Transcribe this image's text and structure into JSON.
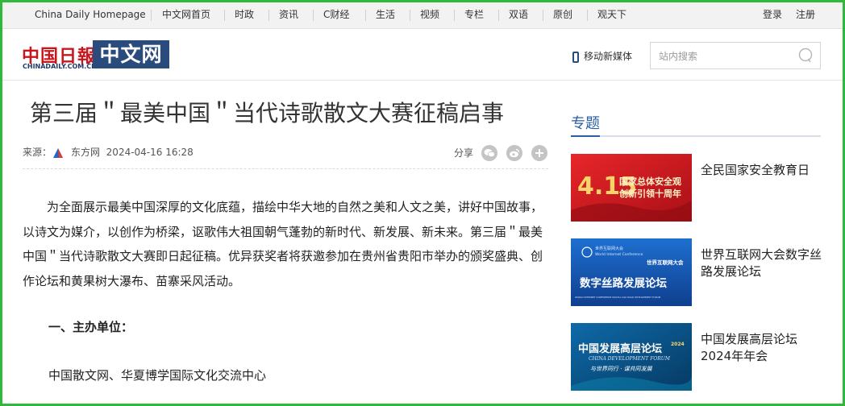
{
  "topnav": {
    "items": [
      "China Daily Homepage",
      "中文网首页",
      "时政",
      "资讯",
      "C财经",
      "生活",
      "视频",
      "专栏",
      "双语",
      "原创",
      "观天下"
    ],
    "login": "登录",
    "register": "注册"
  },
  "header": {
    "logo_cn": "中国日報",
    "logo_url": "CHINADAILY.COM.CN",
    "logo_zw": "中文网",
    "mobile_label": "移动新媒体",
    "search_placeholder": "站内搜索"
  },
  "article": {
    "title": "第三届＂最美中国＂当代诗歌散文大赛征稿启事",
    "source_label": "来源：",
    "source_name": "东方网",
    "datetime": "2024-04-16 16:28",
    "share_label": "分享",
    "paragraph": "为全面展示最美中国深厚的文化底蕴，描绘中华大地的自然之美和人文之美，讲好中国故事，以诗文为媒介，以创作为桥梁，讴歌伟大祖国朝气蓬勃的新时代、新发展、新未来。第三届＂最美中国＂当代诗歌散文大赛即日起征稿。优异获奖者将获邀参加在贵州省贵阳市举办的颁奖盛典、创作论坛和黄果树大瀑布、苗寨采风活动。",
    "section1_heading": "一、主办单位：",
    "section1_text": "中国散文网、华夏博学国际文化交流中心"
  },
  "sidebar": {
    "title": "专题",
    "cards": [
      {
        "caption": "全民国家安全教育日",
        "thumb_big": "4.15",
        "thumb_line1": "国家总体安全观",
        "thumb_line2": "创新引领十周年",
        "thumb_color": "#c8161d"
      },
      {
        "caption": "世界互联网大会数字丝路发展论坛",
        "thumb_small1": "世界互联网大会",
        "thumb_small2": "World Internet Conference",
        "thumb_badge": "世界互联网大会",
        "thumb_main": "数字丝路发展论坛",
        "thumb_foot": "WORLD INTERNET CONFERENCE DIGITAL SILK ROAD DEVELOPMENT FORUM",
        "thumb_color": "#1b5fb8"
      },
      {
        "caption": "中国发展高层论坛2024年年会",
        "thumb_main": "中国发展高层论坛",
        "thumb_year": "2024",
        "thumb_en": "CHINA DEVELOPMENT FORUM",
        "thumb_slogan": "与世界同行 · 谋共同发展",
        "thumb_color": "#0b4f86"
      }
    ]
  }
}
